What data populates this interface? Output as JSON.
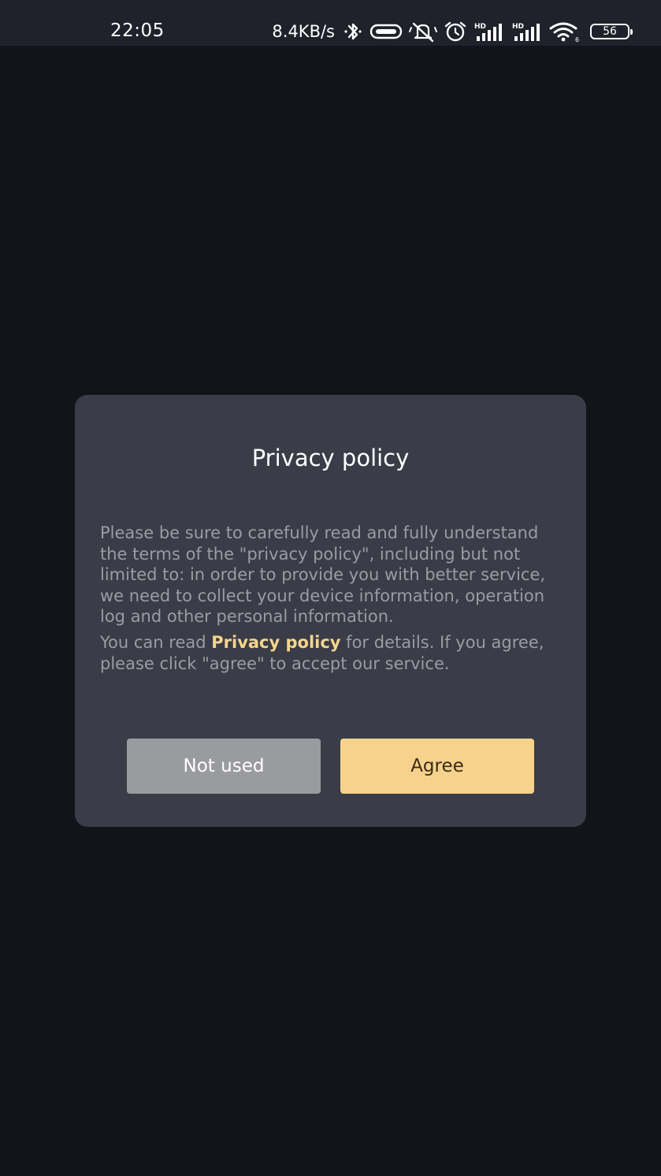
{
  "status_bar": {
    "time": "22:05",
    "net_speed": "8.4KB/s",
    "battery_level": "56",
    "icons": [
      "bluetooth-icon",
      "vibrate-icon",
      "mute-icon",
      "alarm-icon",
      "hd-signal-icon",
      "hd-signal-icon",
      "wifi-icon",
      "battery-icon"
    ]
  },
  "dialog": {
    "title": "Privacy policy",
    "body_paragraph": "Please be sure to carefully read and fully understand the terms of the \"privacy policy\", including but not limited to: in order to provide you with better service, we need to collect your device information, operation log and other personal information.",
    "details_prefix": "You can read ",
    "details_link": "Privacy policy",
    "details_suffix": " for details. If you agree, please click \"agree\" to accept our service.",
    "decline_label": "Not used",
    "agree_label": "Agree"
  },
  "colors": {
    "background": "#111418",
    "dialog_background": "#3a3d47",
    "accent": "#f6d28c",
    "decline_button": "#9a9b9e"
  }
}
